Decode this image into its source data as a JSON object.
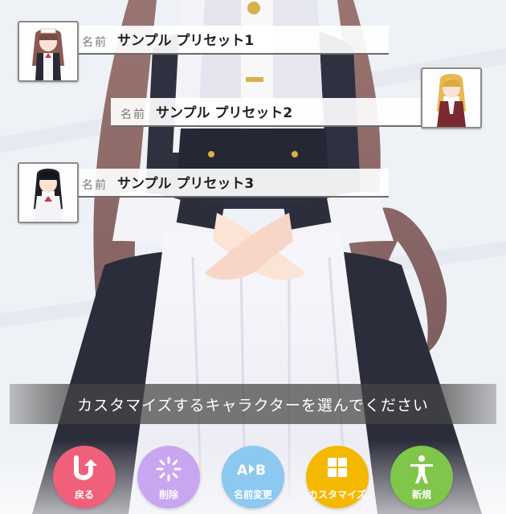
{
  "presets": [
    {
      "label": "名前",
      "name": "サンプル プリセット1",
      "avatar": "maid-brown-hair-avatar"
    },
    {
      "label": "名前",
      "name": "サンプル プリセット2",
      "avatar": "blonde-uniform-avatar"
    },
    {
      "label": "名前",
      "name": "サンプル プリセット3",
      "avatar": "black-hair-school-avatar"
    }
  ],
  "prompt": "カスタマイズするキャラクターを選んでください",
  "actions": [
    {
      "label": "戻る",
      "icon": "back-arrow-icon",
      "color": "#f0607a"
    },
    {
      "label": "削除",
      "icon": "delete-sparkle-icon",
      "color": "#c8a6f0"
    },
    {
      "label": "名前変更",
      "icon": "rename-ab-icon",
      "color": "#8cc8f0"
    },
    {
      "label": "カスタマイズ",
      "icon": "customize-grid-icon",
      "color": "#f5b800"
    },
    {
      "label": "新規",
      "icon": "new-figure-icon",
      "color": "#7fc64a"
    }
  ]
}
